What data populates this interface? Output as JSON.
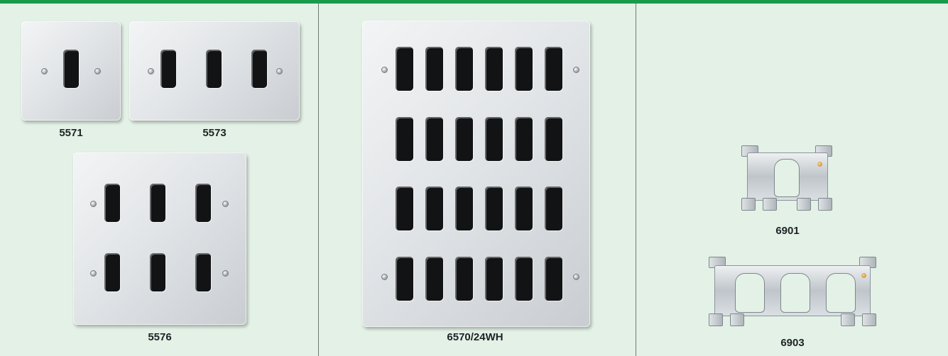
{
  "accent_color": "#1a9a4c",
  "background_color": "#e3f1e6",
  "products": {
    "p5571": {
      "code": "5571",
      "icon": "single-gang-grid-plate-icon",
      "apertures": 1
    },
    "p5573": {
      "code": "5573",
      "icon": "triple-gang-grid-plate-icon",
      "apertures": 3
    },
    "p5576": {
      "code": "5576",
      "icon": "six-gang-grid-plate-icon",
      "apertures": 6
    },
    "p6570": {
      "code": "6570/24WH",
      "icon": "twenty-four-gang-grid-plate-icon",
      "apertures": 24
    },
    "p6901": {
      "code": "6901",
      "icon": "single-gang-grid-frame-icon",
      "apertures": 1
    },
    "p6903": {
      "code": "6903",
      "icon": "triple-gang-grid-frame-icon",
      "apertures": 3
    }
  }
}
